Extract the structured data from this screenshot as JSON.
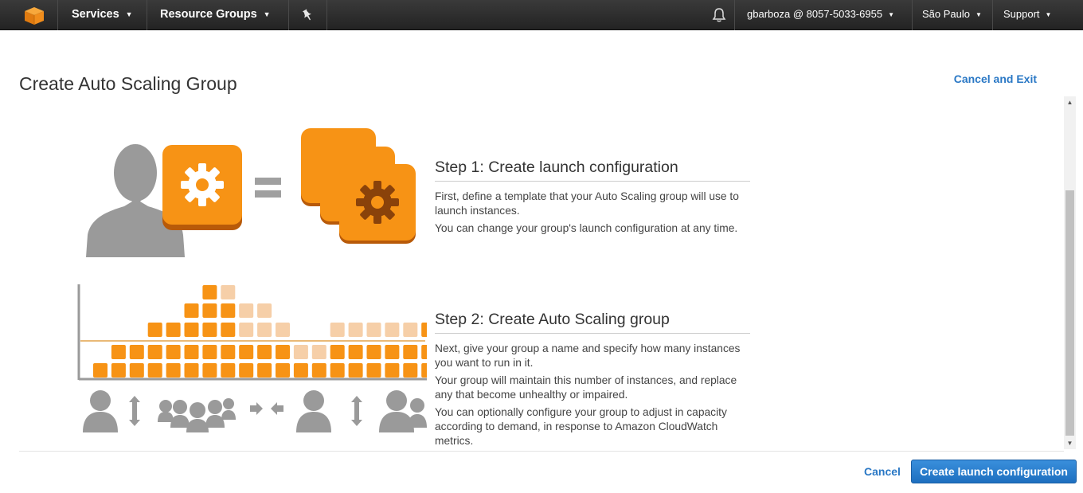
{
  "nav": {
    "services": "Services",
    "resource_groups": "Resource Groups",
    "account": "gbarboza @ 8057-5033-6955",
    "region": "São Paulo",
    "support": "Support"
  },
  "page": {
    "title": "Create Auto Scaling Group",
    "cancel_exit": "Cancel and Exit"
  },
  "step1": {
    "heading": "Step 1: Create launch configuration",
    "p1": "First, define a template that your Auto Scaling group will use to launch instances.",
    "p2": "You can change your group's launch configuration at any time."
  },
  "step2": {
    "heading": "Step 2: Create Auto Scaling group",
    "p1": "Next, give your group a name and specify how many instances you want to run in it.",
    "p2": "Your group will maintain this number of instances, and replace any that become unhealthy or impaired.",
    "p3": "You can optionally configure your group to adjust in capacity according to demand, in response to Amazon CloudWatch metrics."
  },
  "footer": {
    "cancel": "Cancel",
    "create": "Create launch configuration"
  },
  "colors": {
    "nav_bg": "#2b2b2b",
    "orange": "#f79315",
    "orange_light": "#f6cfa8",
    "link": "#2a78c5",
    "primary_button": "#2a7fd0",
    "silhouette": "#9a9a9a"
  },
  "icons": {
    "logo": "aws-cube-icon",
    "pin": "pin-icon",
    "bell": "bell-icon"
  }
}
